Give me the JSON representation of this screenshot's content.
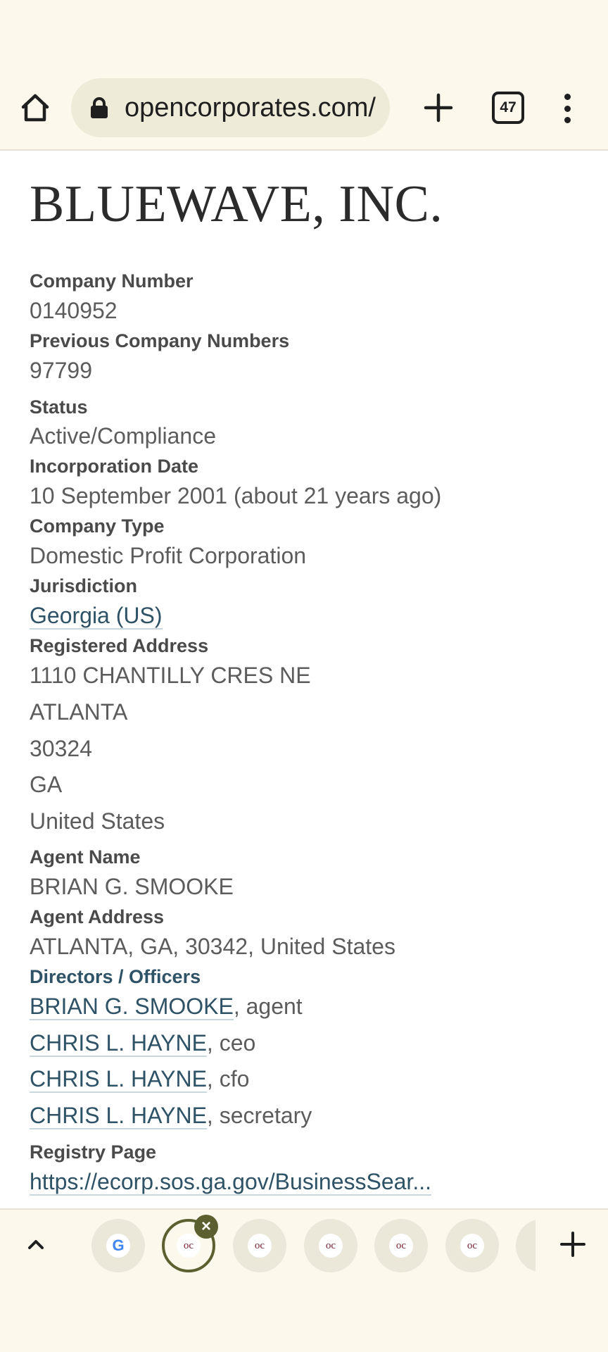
{
  "browser": {
    "url": "opencorporates.com/",
    "tab_count": "47"
  },
  "company": {
    "name": "BLUEWAVE, INC.",
    "fields": {
      "company_number_label": "Company Number",
      "company_number": "0140952",
      "previous_numbers_label": "Previous Company Numbers",
      "previous_numbers": "97799",
      "status_label": "Status",
      "status": "Active/Compliance",
      "incorporation_date_label": "Incorporation Date",
      "incorporation_date": "10 September 2001 (about 21 years ago)",
      "company_type_label": "Company Type",
      "company_type": "Domestic Profit Corporation",
      "jurisdiction_label": "Jurisdiction",
      "jurisdiction": "Georgia (US)",
      "registered_address_label": "Registered Address",
      "address_lines": [
        "1110 CHANTILLY CRES NE",
        "ATLANTA",
        "30324",
        "GA",
        "United States"
      ],
      "agent_name_label": "Agent Name",
      "agent_name": "BRIAN G. SMOOKE",
      "agent_address_label": "Agent Address",
      "agent_address": "ATLANTA, GA, 30342, United States",
      "directors_label": "Directors / Officers",
      "officers": [
        {
          "name": "BRIAN G. SMOOKE",
          "role": ", agent"
        },
        {
          "name": "CHRIS L. HAYNE",
          "role": ", ceo"
        },
        {
          "name": "CHRIS L. HAYNE",
          "role": ", cfo"
        },
        {
          "name": "CHRIS L. HAYNE",
          "role": ", secretary"
        }
      ],
      "registry_page_label": "Registry Page",
      "registry_page_url": "https://ecorp.sos.ga.gov/BusinessSear..."
    }
  },
  "tab_strip": {
    "tabs": [
      {
        "favicon": "google-icon",
        "glyph": "G"
      },
      {
        "favicon": "opencorporates-icon",
        "glyph": "oc",
        "active": true
      },
      {
        "favicon": "opencorporates-icon",
        "glyph": "oc"
      },
      {
        "favicon": "opencorporates-icon",
        "glyph": "oc"
      },
      {
        "favicon": "opencorporates-icon",
        "glyph": "oc"
      },
      {
        "favicon": "opencorporates-icon",
        "glyph": "oc"
      }
    ]
  },
  "colors": {
    "chrome_bg": "#fcf9ec",
    "link": "#2e5266",
    "label": "#4a4a4a",
    "value": "#5c5c5c",
    "active_tab_ring": "#5c6030"
  }
}
